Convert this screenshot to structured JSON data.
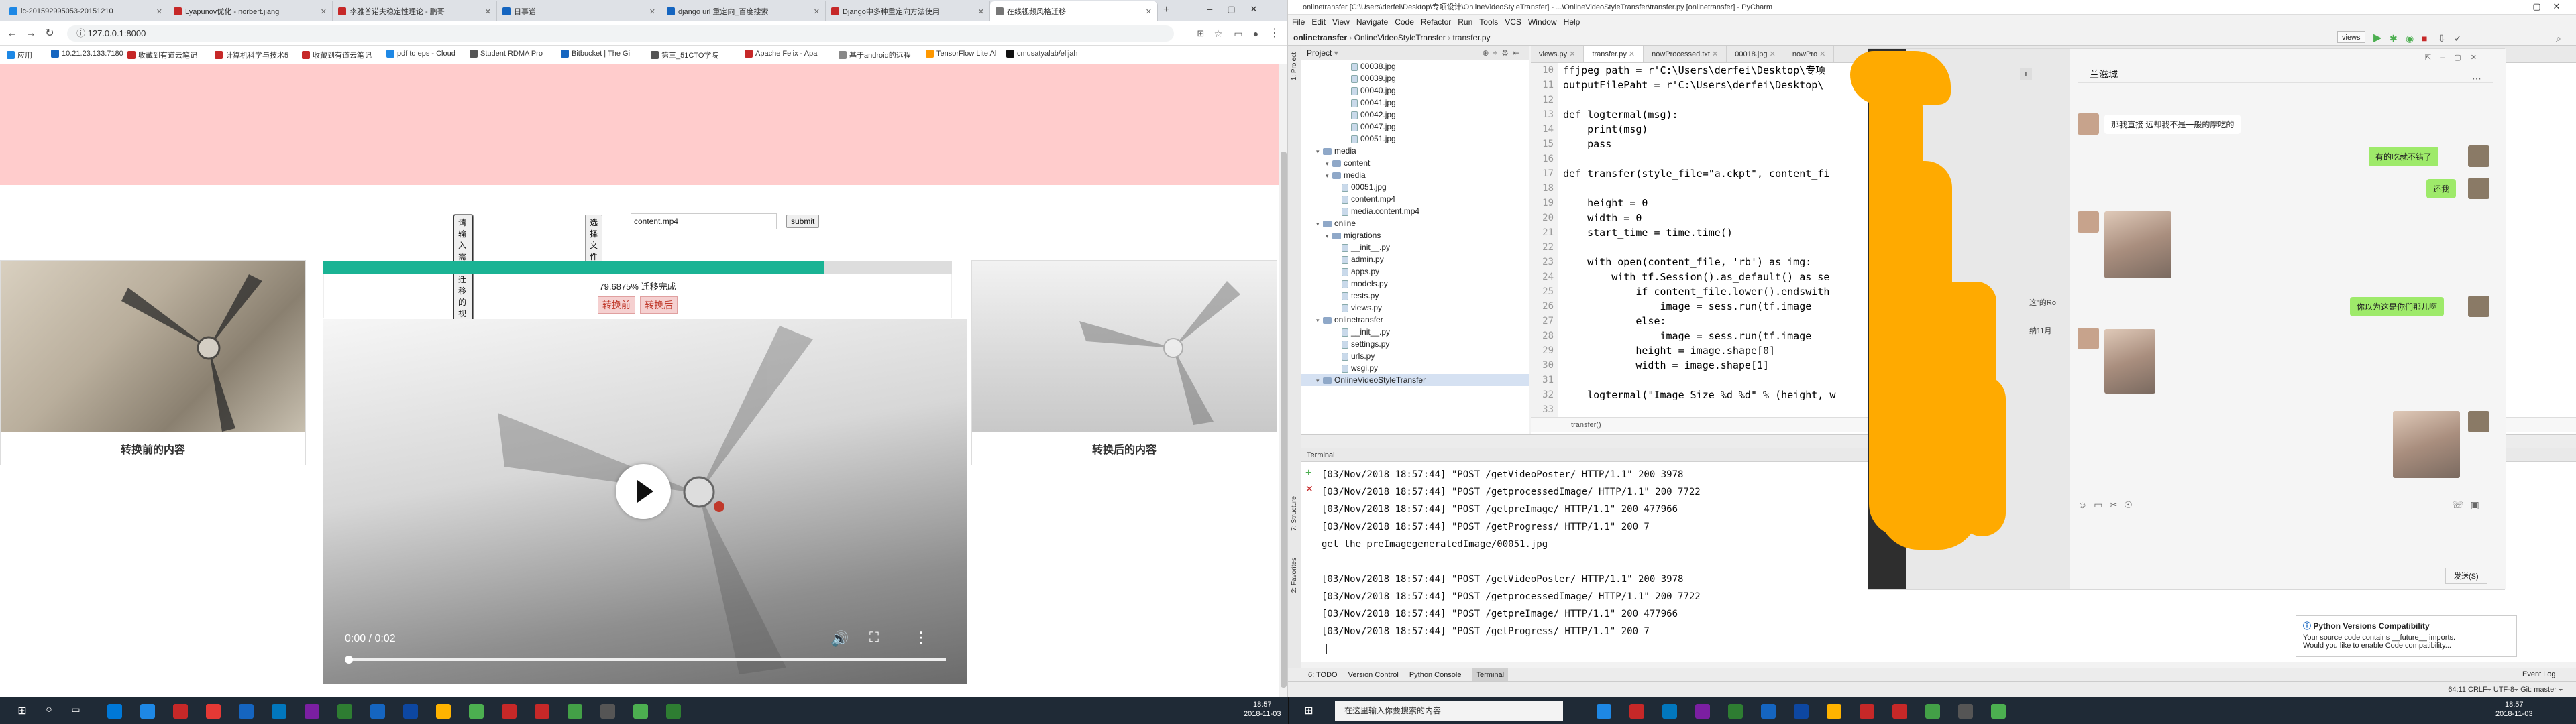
{
  "browser": {
    "tabs": [
      {
        "title": "lc-201592995053-20151210",
        "color": "#1e88e5"
      },
      {
        "title": "Lyapunov优化 - norbert.jiang",
        "color": "#c62828"
      },
      {
        "title": "李雅普诺夫稳定性理论 - 鹏哥",
        "color": "#c62828"
      },
      {
        "title": "日事谱",
        "color": "#1565c0"
      },
      {
        "title": "django url 重定向_百度搜索",
        "color": "#1565c0"
      },
      {
        "title": "Django中多种重定向方法使用",
        "color": "#c62828"
      },
      {
        "title": "在线视频风格迁移",
        "color": "#777777"
      }
    ],
    "url": "127.0.0.1:8000",
    "bookmarks": [
      "应用",
      "10.21.23.133:7180",
      "收藏到有道云笔记",
      "计算机科学与技术5",
      "收藏到有道云笔记",
      "pdf to eps - Cloud",
      "Student RDMA Pro",
      "Bitbucket | The Gi",
      "第三_51CTO学院",
      "Apache Felix - Apa",
      "基于android的远程",
      "TensorFlow Lite Al",
      "cmusatyalab/elijah"
    ],
    "upload": {
      "label": "请输入需要迁移的视频文件:",
      "choose_button": "选择文件",
      "file_name": "content.mp4",
      "submit": "submit"
    },
    "progress": {
      "value": 0.796875,
      "text": "79.6875% 迁移完成"
    },
    "buttons": {
      "before": "转换前",
      "after": "转换后"
    },
    "captions": {
      "left": "转换前的内容",
      "right": "转换后的内容"
    },
    "video": {
      "time": "0:00 / 0:02"
    }
  },
  "ide": {
    "title": "onlinetransfer [C:\\Users\\derfei\\Desktop\\专项设计\\OnlineVideoStyleTransfer] - ...\\OnlineVideoStyleTransfer\\transfer.py [onlinetransfer] - PyCharm",
    "menu": [
      "File",
      "Edit",
      "View",
      "Navigate",
      "Code",
      "Refactor",
      "Run",
      "Tools",
      "VCS",
      "Window",
      "Help"
    ],
    "breadcrumbs": [
      "onlinetransfer",
      "OnlineVideoStyleTransfer",
      "transfer.py"
    ],
    "run_config": "views",
    "project_header": "Project",
    "tree": [
      {
        "label": "00038.jpg",
        "indent": 4,
        "type": "file"
      },
      {
        "label": "00039.jpg",
        "indent": 4,
        "type": "file"
      },
      {
        "label": "00040.jpg",
        "indent": 4,
        "type": "file"
      },
      {
        "label": "00041.jpg",
        "indent": 4,
        "type": "file"
      },
      {
        "label": "00042.jpg",
        "indent": 4,
        "type": "file"
      },
      {
        "label": "00047.jpg",
        "indent": 4,
        "type": "file"
      },
      {
        "label": "00051.jpg",
        "indent": 4,
        "type": "file"
      },
      {
        "label": "media",
        "indent": 1,
        "type": "folder"
      },
      {
        "label": "content",
        "indent": 2,
        "type": "folder"
      },
      {
        "label": "media",
        "indent": 2,
        "type": "folder"
      },
      {
        "label": "00051.jpg",
        "indent": 3,
        "type": "file"
      },
      {
        "label": "content.mp4",
        "indent": 3,
        "type": "file"
      },
      {
        "label": "media.content.mp4",
        "indent": 3,
        "type": "file"
      },
      {
        "label": "online",
        "indent": 1,
        "type": "folder"
      },
      {
        "label": "migrations",
        "indent": 2,
        "type": "folder"
      },
      {
        "label": "__init__.py",
        "indent": 3,
        "type": "file"
      },
      {
        "label": "admin.py",
        "indent": 3,
        "type": "file"
      },
      {
        "label": "apps.py",
        "indent": 3,
        "type": "file"
      },
      {
        "label": "models.py",
        "indent": 3,
        "type": "file"
      },
      {
        "label": "tests.py",
        "indent": 3,
        "type": "file"
      },
      {
        "label": "views.py",
        "indent": 3,
        "type": "file"
      },
      {
        "label": "onlinetransfer",
        "indent": 1,
        "type": "folder"
      },
      {
        "label": "__init__.py",
        "indent": 3,
        "type": "file"
      },
      {
        "label": "settings.py",
        "indent": 3,
        "type": "file"
      },
      {
        "label": "urls.py",
        "indent": 3,
        "type": "file"
      },
      {
        "label": "wsgi.py",
        "indent": 3,
        "type": "file"
      },
      {
        "label": "OnlineVideoStyleTransfer",
        "indent": 1,
        "type": "folder"
      }
    ],
    "editor_tabs": [
      "views.py",
      "transfer.py",
      "nowProcessed.txt",
      "00018.jpg",
      "nowPro"
    ],
    "active_tab": "transfer.py",
    "line_numbers": [
      "10",
      "11",
      "12",
      "13",
      "14",
      "15",
      "16",
      "17",
      "18",
      "19",
      "20",
      "21",
      "22",
      "23",
      "24",
      "25",
      "26",
      "27",
      "28",
      "29",
      "30",
      "31",
      "32",
      "33"
    ],
    "code_lines": [
      "ffjpeg_path = r'C:\\Users\\derfei\\Desktop\\专项",
      "outputFilePaht = r'C:\\Users\\derfei\\Desktop\\",
      "",
      "def logtermal(msg):",
      "    print(msg)",
      "    pass",
      "",
      "def transfer(style_file=\"a.ckpt\", content_fi",
      "",
      "    height = 0",
      "    width = 0",
      "    start_time = time.time()",
      "",
      "    with open(content_file, 'rb') as img:",
      "        with tf.Session().as_default() as se",
      "            if content_file.lower().endswith",
      "                image = sess.run(tf.image",
      "            else:",
      "                image = sess.run(tf.image",
      "            height = image.shape[0]",
      "            width = image.shape[1]",
      "",
      "    logtermal(\"Image Size %d %d\" % (height, w",
      ""
    ],
    "editor_footer": "transfer()",
    "terminal_header": "Terminal",
    "terminal_lines": [
      "[03/Nov/2018 18:57:44] \"POST /getVideoPoster/ HTTP/1.1\" 200 3978",
      "[03/Nov/2018 18:57:44] \"POST /getprocessedImage/ HTTP/1.1\" 200 7722",
      "[03/Nov/2018 18:57:44] \"POST /getpreImage/ HTTP/1.1\" 200 477966",
      "[03/Nov/2018 18:57:44] \"POST /getProgress/ HTTP/1.1\" 200 7",
      "get the preImagegeneratedImage/00051.jpg",
      "",
      "[03/Nov/2018 18:57:44] \"POST /getVideoPoster/ HTTP/1.1\" 200 3978",
      "[03/Nov/2018 18:57:44] \"POST /getprocessedImage/ HTTP/1.1\" 200 7722",
      "[03/Nov/2018 18:57:44] \"POST /getpreImage/ HTTP/1.1\" 200 477966",
      "[03/Nov/2018 18:57:44] \"POST /getProgress/ HTTP/1.1\" 200 7"
    ],
    "bottom_tabs": [
      "6: TODO",
      "Version Control",
      "Python Console",
      "Terminal"
    ],
    "event_log": "Event Log",
    "status": "64:11  CRLF÷  UTF-8÷  Git: master ÷",
    "notification": {
      "title": "Python Versions Compatibility",
      "line1": "Your source code contains __future__ imports.",
      "line2": "Would you like to enable Code compatibility..."
    }
  },
  "chat": {
    "contact": "兰滋城",
    "messages_left": [
      "那我直接 远却我不是一般的摩吃的"
    ],
    "messages_right": [
      "有的吃就不错了",
      "还我",
      "你以为这是你们那儿啊"
    ],
    "send_button": "发送(S)",
    "side_fragments": [
      "这\"的Ro",
      "纳11月"
    ]
  },
  "taskbar": {
    "search_placeholder": "在这里输入你要搜索的内容",
    "time": "18:57",
    "date": "2018-11-03",
    "time2": "18:57",
    "date2": "2018-11-03"
  }
}
